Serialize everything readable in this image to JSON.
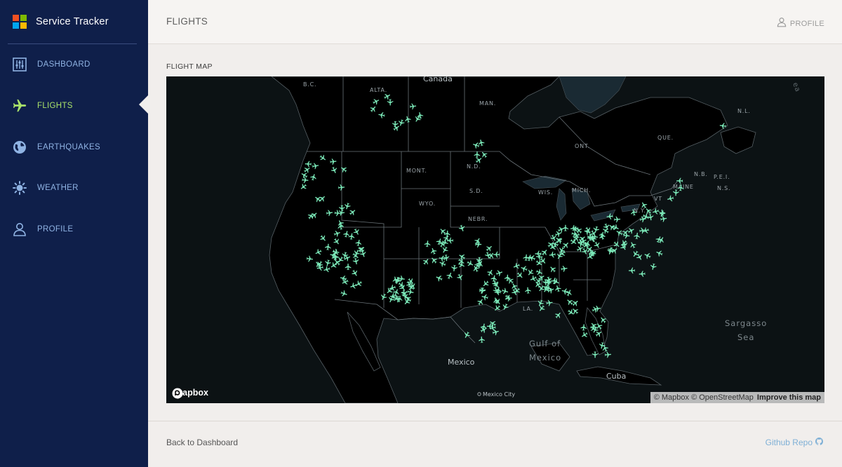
{
  "app": {
    "title": "Service Tracker",
    "logo_colors": [
      "#f25022",
      "#7fba00",
      "#00a4ef",
      "#ffb900"
    ]
  },
  "sidebar": {
    "items": [
      {
        "label": "DASHBOARD",
        "icon": "sliders-icon",
        "active": false
      },
      {
        "label": "FLIGHTS",
        "icon": "airplane-icon",
        "active": true
      },
      {
        "label": "EARTHQUAKES",
        "icon": "globe-icon",
        "active": false
      },
      {
        "label": "WEATHER",
        "icon": "sun-icon",
        "active": false
      },
      {
        "label": "PROFILE",
        "icon": "user-icon",
        "active": false
      }
    ],
    "active_color": "#a9e26a",
    "item_color": "#8fb3e3"
  },
  "header": {
    "title": "FLIGHTS",
    "profile_label": "PROFILE"
  },
  "main": {
    "section_title": "FLIGHT MAP"
  },
  "map": {
    "labels": {
      "canada": "Canada",
      "bc": "B.C.",
      "alta": "ALTA.",
      "man": "MAN.",
      "nl": "N.L.",
      "que": "QUE.",
      "ont": "ONT.",
      "mont": "MONT.",
      "nd": "N.D.",
      "nb": "N.B.",
      "pei": "P.E.I.",
      "ns": "N.S.",
      "sd": "S.D.",
      "wis": "WIS.",
      "mich": "MICH.",
      "maine": "MAINE",
      "vt": "VT",
      "wyo": "WYO.",
      "ny": "N.Y.",
      "nebr": "NEBR.",
      "la": "LA.",
      "sargasso_1": "Sargasso",
      "sargasso_2": "Sea",
      "gulf_1": "Gulf of",
      "gulf_2": "Mexico",
      "mexico": "Mexico",
      "cuba": "Cuba",
      "mexico_city": "Mexico City",
      "ocean_fragment": "ea"
    },
    "plane_color": "#7be8b8",
    "attribution": {
      "mapbox": "© Mapbox",
      "osm": "© OpenStreetMap",
      "improve": "Improve this map"
    },
    "logo_text": "mapbox"
  },
  "footer": {
    "back_label": "Back to Dashboard",
    "github_label": "Github Repo"
  }
}
